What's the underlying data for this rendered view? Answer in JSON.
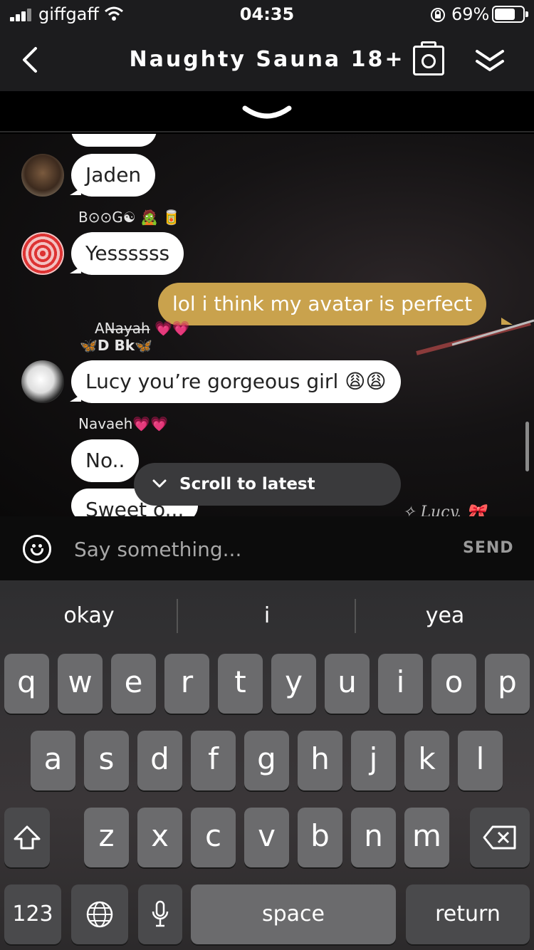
{
  "status": {
    "carrier": "giffgaff",
    "time": "04:35",
    "battery": "69%"
  },
  "header": {
    "title": "Naughty Sauna 18+"
  },
  "messages": [
    {
      "user": "",
      "text": "Jaden"
    },
    {
      "user": "B⊙⊙G☯ 🧟 🥫",
      "text": "Yessssss"
    },
    {
      "mine": true,
      "text": "lol i think my  avatar is perfect"
    },
    {
      "user": "AN̶a̶y̶a̶h̶ 💗💗",
      "user2": "🦋D Bk🦋",
      "text": "Lucy you’re gorgeous girl 😩😩"
    },
    {
      "user": "Navaeh💗💗",
      "text": "No.."
    },
    {
      "user": "",
      "text": "Sweet o..."
    }
  ],
  "scroll_latest": "Scroll to latest message",
  "lucy_tag": "Lucy.",
  "input": {
    "placeholder": "Say something...",
    "send": "SEND"
  },
  "suggestions": [
    "okay",
    "i",
    "yea"
  ],
  "keys": {
    "row1": [
      "q",
      "w",
      "e",
      "r",
      "t",
      "y",
      "u",
      "i",
      "o",
      "p"
    ],
    "row2": [
      "a",
      "s",
      "d",
      "f",
      "g",
      "h",
      "j",
      "k",
      "l"
    ],
    "row3": [
      "z",
      "x",
      "c",
      "v",
      "b",
      "n",
      "m"
    ],
    "numbers": "123",
    "space": "space",
    "return": "return"
  },
  "colors": {
    "my_bubble": "#c9a24d",
    "other_bubble": "#ffffff"
  }
}
